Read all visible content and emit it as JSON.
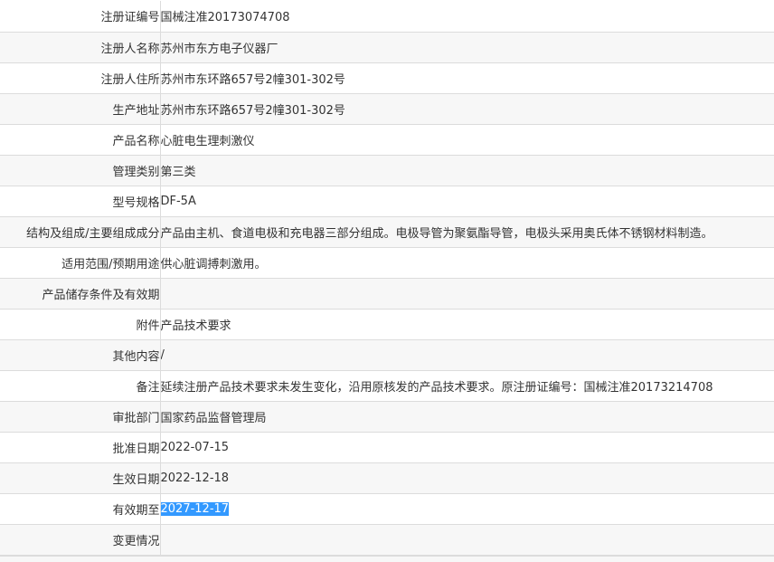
{
  "rows": [
    {
      "label": "注册证编号",
      "value": "国械注准20173074708"
    },
    {
      "label": "注册人名称",
      "value": "苏州市东方电子仪器厂"
    },
    {
      "label": "注册人住所",
      "value": "苏州市东环路657号2幢301-302号"
    },
    {
      "label": "生产地址",
      "value": "苏州市东环路657号2幢301-302号"
    },
    {
      "label": "产品名称",
      "value": "心脏电生理刺激仪"
    },
    {
      "label": "管理类别",
      "value": "第三类"
    },
    {
      "label": "型号规格",
      "value": "DF-5A"
    },
    {
      "label": "结构及组成/主要组成成分",
      "value": "产品由主机、食道电极和充电器三部分组成。电极导管为聚氨酯导管，电极头采用奥氏体不锈钢材料制造。"
    },
    {
      "label": "适用范围/预期用途",
      "value": "供心脏调搏刺激用。"
    },
    {
      "label": "产品储存条件及有效期",
      "value": ""
    },
    {
      "label": "附件",
      "value": "产品技术要求"
    },
    {
      "label": "其他内容",
      "value": "/"
    },
    {
      "label": "备注",
      "value": "延续注册产品技术要求未发生变化，沿用原核发的产品技术要求。原注册证编号：国械注准20173214708"
    },
    {
      "label": "审批部门",
      "value": "国家药品监督管理局"
    },
    {
      "label": "批准日期",
      "value": "2022-07-15"
    },
    {
      "label": "生效日期",
      "value": "2022-12-18"
    },
    {
      "label": "有效期至",
      "value": "2027-12-17"
    },
    {
      "label": "变更情况",
      "value": ""
    }
  ]
}
